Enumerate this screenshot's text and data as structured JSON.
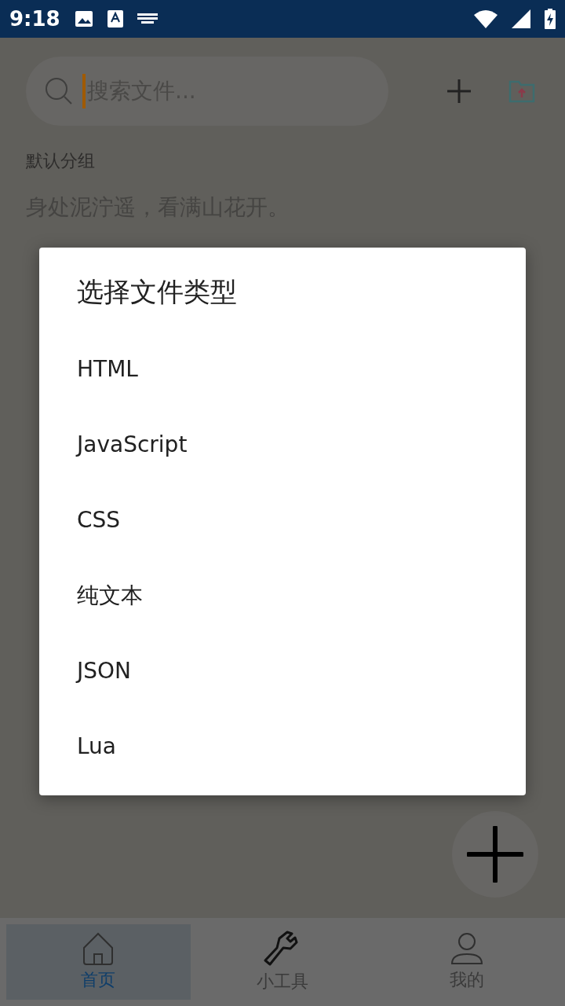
{
  "status_bar": {
    "time": "9:18"
  },
  "search": {
    "placeholder": "搜索文件..."
  },
  "group": {
    "label": "默认分组",
    "files": [
      {
        "name": "身处泥泞遥，看满山花开。"
      }
    ]
  },
  "dialog": {
    "title": "选择文件类型",
    "options": [
      {
        "label": "HTML"
      },
      {
        "label": "JavaScript"
      },
      {
        "label": "CSS"
      },
      {
        "label": "纯文本"
      },
      {
        "label": "JSON"
      },
      {
        "label": "Lua"
      }
    ]
  },
  "bottom_nav": [
    {
      "label": "首页",
      "selected": true
    },
    {
      "label": "小工具",
      "selected": false
    },
    {
      "label": "我的",
      "selected": false
    }
  ]
}
